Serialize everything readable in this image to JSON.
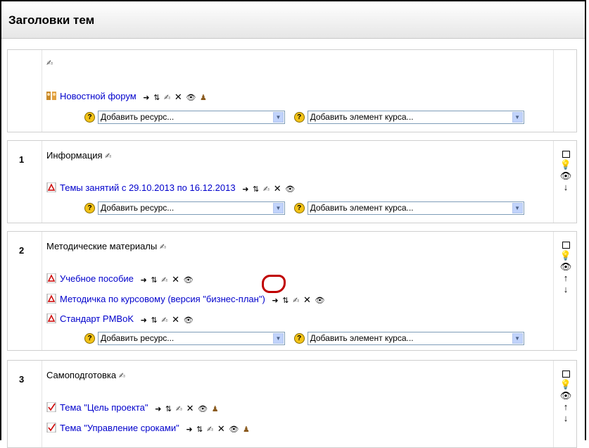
{
  "header": {
    "title": "Заголовки тем"
  },
  "add_resource_placeholder": "Добавить ресурс...",
  "add_activity_placeholder": "Добавить элемент курса...",
  "sections": [
    {
      "number": "",
      "title": "",
      "items": [
        {
          "label": "Новостной форум",
          "icon": "forum-icon"
        }
      ]
    },
    {
      "number": "1",
      "title": "Информация",
      "items": [
        {
          "label": "Темы занятий с 29.10.2013 по 16.12.2013",
          "icon": "pdf-icon"
        }
      ]
    },
    {
      "number": "2",
      "title": "Методические материалы",
      "items": [
        {
          "label": "Учебное пособие",
          "icon": "pdf-icon"
        },
        {
          "label": "Методичка по курсовому (версия \"бизнес-план\")",
          "icon": "pdf-icon"
        },
        {
          "label": "Стандарт PMBoK",
          "icon": "pdf-icon"
        }
      ]
    },
    {
      "number": "3",
      "title": "Самоподготовка",
      "items": [
        {
          "label": "Тема \"Цель проекта\"",
          "icon": "quiz-icon"
        },
        {
          "label": "Тема \"Управление сроками\"",
          "icon": "quiz-icon"
        }
      ]
    }
  ],
  "colors": {
    "link": "#0000cc",
    "annotation": "#c00000",
    "help": "#f3c318"
  }
}
